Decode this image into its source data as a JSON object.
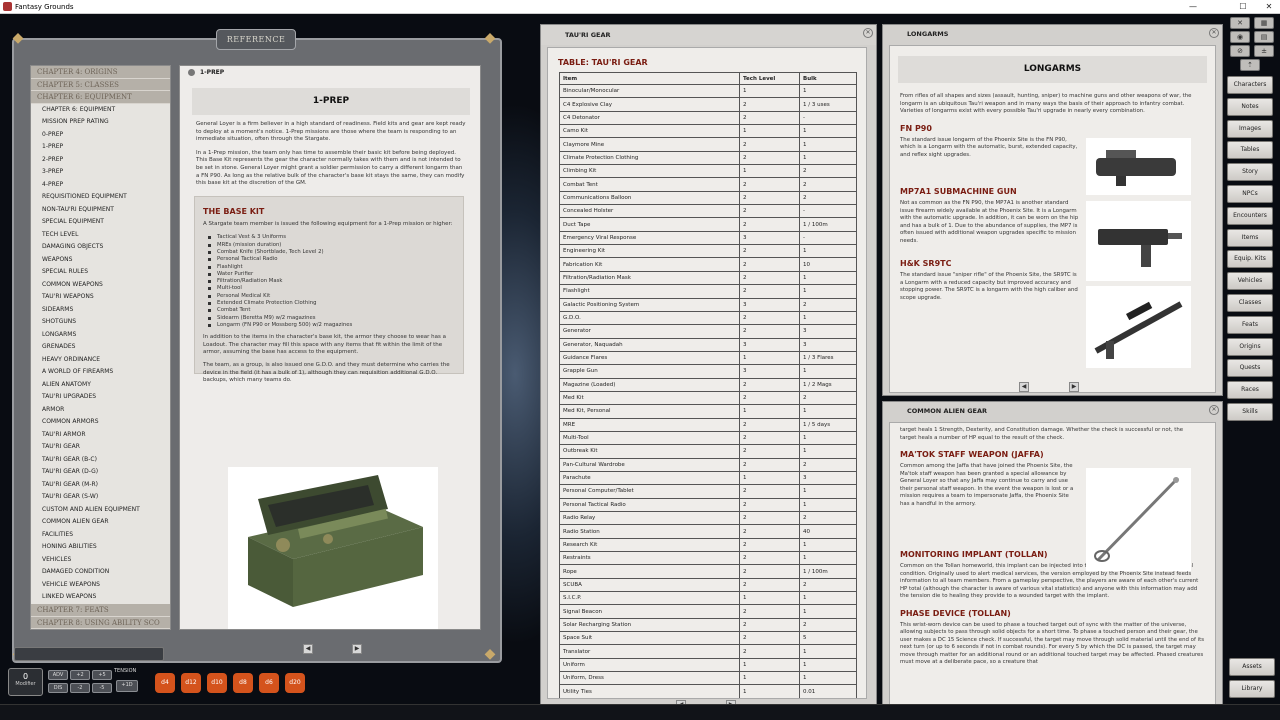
{
  "app": {
    "title": "Fantasy Grounds"
  },
  "window_controls": {
    "minimize": "—",
    "maximize": "☐",
    "close": "✕"
  },
  "reference": {
    "title": "REFERENCE",
    "toc": {
      "chapters_top": [
        "CHAPTER 4: ORIGINS",
        "CHAPTER 5: CLASSES",
        "CHAPTER 6: EQUIPMENT"
      ],
      "entries": [
        "CHAPTER 6: EQUIPMENT",
        "MISSION PREP RATING",
        "0-PREP",
        "1-PREP",
        "2-PREP",
        "3-PREP",
        "4-PREP",
        "REQUISITIONED EQUIPMENT",
        "NON-TAU'RI EQUIPMENT",
        "SPECIAL EQUIPMENT",
        "TECH LEVEL",
        "DAMAGING OBJECTS",
        "WEAPONS",
        "SPECIAL RULES",
        "COMMON WEAPONS",
        "TAU'RI WEAPONS",
        "SIDEARMS",
        "SHOTGUNS",
        "LONGARMS",
        "GRENADES",
        "HEAVY ORDINANCE",
        "A WORLD OF FIREARMS",
        "ALIEN ANATOMY",
        "TAU'RI UPGRADES",
        "ARMOR",
        "COMMON ARMORS",
        "TAU'RI ARMOR",
        "TAU'RI GEAR",
        "TAU'RI GEAR (B-C)",
        "TAU'RI GEAR (D-G)",
        "TAU'RI GEAR (M-R)",
        "TAU'RI GEAR (S-W)",
        "CUSTOM AND ALIEN EQUIPMENT",
        "COMMON ALIEN GEAR",
        "FACILITIES",
        "HONING ABILITIES",
        "VEHICLES",
        "DAMAGED CONDITION",
        "VEHICLE WEAPONS",
        "LINKED WEAPONS"
      ],
      "chapters_bottom": [
        "CHAPTER 7: FEATS",
        "CHAPTER 8: USING ABILITY SCO"
      ]
    },
    "content": {
      "subheader": "1-PREP",
      "banner": "1-PREP",
      "para1": "General Loyer is a firm believer in a high standard of readiness. Field kits and gear are kept ready to deploy at a moment's notice. 1-Prep missions are those where the team is responding to an immediate situation, often through the Stargate.",
      "para2": "In a 1-Prep mission, the team only has time to assemble their basic kit before being deployed. This Base Kit represents the gear the character normally takes with them and is not intended to be set in stone. General Loyer might grant a soldier permission to carry a different longarm than a FN P90. As long as the relative bulk of the character's base kit stays the same, they can modify this base kit at the discretion of the GM.",
      "basekit": {
        "title": "THE BASE KIT",
        "intro": "A Stargate team member is issued the following equipment for a 1-Prep mission or higher:",
        "items": [
          "Tactical Vest & 3 Uniforms",
          "MREs (mission duration)",
          "Combat Knife (Shortblade, Tech Level 2)",
          "Personal Tactical Radio",
          "Flashlight",
          "Water Purifier",
          "Filtration/Radiation Mask",
          "Multi-tool",
          "Personal Medical Kit",
          "Extended Climate Protection Clothing",
          "Combat Tent",
          "Sidearm (Beretta M9) w/2 magazines",
          "Longarm (FN P90 or Mossberg 500) w/2 magazines"
        ],
        "para3": "In addition to the items in the character's base kit, the armor they choose to wear has a Loadout. The character may fill this space with any items that fit within the limit of the armor, assuming the base has access to the equipment.",
        "para4": "The team, as a group, is also issued one G.D.O. and they must determine who carries the device in the field (it has a bulk of 1), although they can requisition additional G.D.O. backups, which many teams do."
      }
    }
  },
  "gear": {
    "title": "TAU'RI GEAR",
    "table_title": "TABLE: TAU'RI GEAR",
    "columns": [
      "Item",
      "Tech Level",
      "Bulk"
    ],
    "rows": [
      [
        "Binocular/Monocular",
        "1",
        "1"
      ],
      [
        "C4 Explosive Clay",
        "2",
        "1 / 3 uses"
      ],
      [
        "C4 Detonator",
        "2",
        "-"
      ],
      [
        "Camo Kit",
        "1",
        "1"
      ],
      [
        "Claymore Mine",
        "2",
        "1"
      ],
      [
        "Climate Protection Clothing",
        "2",
        "1"
      ],
      [
        "Climbing Kit",
        "1",
        "2"
      ],
      [
        "Combat Tent",
        "2",
        "2"
      ],
      [
        "Communications Balloon",
        "2",
        "2"
      ],
      [
        "Concealed Holster",
        "2",
        "-"
      ],
      [
        "Duct Tape",
        "2",
        "1 / 100m"
      ],
      [
        "Emergency Viral Response",
        "3",
        "-"
      ],
      [
        "Engineering Kit",
        "2",
        "1"
      ],
      [
        "Fabrication Kit",
        "2",
        "10"
      ],
      [
        "Filtration/Radiation Mask",
        "2",
        "1"
      ],
      [
        "Flashlight",
        "2",
        "1"
      ],
      [
        "Galactic Positioning System",
        "3",
        "2"
      ],
      [
        "G.D.O.",
        "2",
        "1"
      ],
      [
        "Generator",
        "2",
        "3"
      ],
      [
        "Generator, Naquadah",
        "3",
        "3"
      ],
      [
        "Guidance Flares",
        "1",
        "1 / 3 Flares"
      ],
      [
        "Grapple Gun",
        "3",
        "1"
      ],
      [
        "Magazine (Loaded)",
        "2",
        "1 / 2 Mags"
      ],
      [
        "Med Kit",
        "2",
        "2"
      ],
      [
        "Med Kit, Personal",
        "1",
        "1"
      ],
      [
        "MRE",
        "2",
        "1 / 5 days"
      ],
      [
        "Multi-Tool",
        "2",
        "1"
      ],
      [
        "Outbreak Kit",
        "2",
        "1"
      ],
      [
        "Pan-Cultural Wardrobe",
        "2",
        "2"
      ],
      [
        "Parachute",
        "1",
        "3"
      ],
      [
        "Personal Computer/Tablet",
        "2",
        "1"
      ],
      [
        "Personal Tactical Radio",
        "2",
        "1"
      ],
      [
        "Radio Relay",
        "2",
        "2"
      ],
      [
        "Radio Station",
        "2",
        "40"
      ],
      [
        "Research Kit",
        "2",
        "1"
      ],
      [
        "Restraints",
        "2",
        "1"
      ],
      [
        "Rope",
        "2",
        "1 / 100m"
      ],
      [
        "SCUBA",
        "2",
        "2"
      ],
      [
        "S.I.C.P.",
        "1",
        "1"
      ],
      [
        "Signal Beacon",
        "2",
        "1"
      ],
      [
        "Solar Recharging Station",
        "2",
        "2"
      ],
      [
        "Space Suit",
        "2",
        "5"
      ],
      [
        "Translator",
        "2",
        "1"
      ],
      [
        "Uniform",
        "1",
        "1"
      ],
      [
        "Uniform, Dress",
        "1",
        "1"
      ],
      [
        "Utility Ties",
        "1",
        "0.01"
      ]
    ]
  },
  "longarms": {
    "title": "LONGARMS",
    "banner": "LONGARMS",
    "intro": "From rifles of all shapes and sizes (assault, hunting, sniper) to machine guns and other weapons of war, the longarm is an ubiquitous Tau'ri weapon and in many ways the basis of their approach to infantry combat. Varieties of longarms exist with every possible Tau'ri upgrade in nearly every combination.",
    "weapons": [
      {
        "name": "FN P90",
        "desc": "The standard issue longarm of the Phoenix Site is the FN P90, which is a Longarm with the automatic, burst, extended capacity, and reflex sight upgrades."
      },
      {
        "name": "MP7A1 SUBMACHINE GUN",
        "desc": "Not as common as the FN P90, the MP7A1 is another standard issue firearm widely available at the Phoenix Site. It is a Longarm with the automatic upgrade. In addition, it can be worn on the hip and has a bulk of 1. Due to the abundance of supplies, the MP7 is often issued with additional weapon upgrades specific to mission needs."
      },
      {
        "name": "H&K SR9TC",
        "desc": "The standard issue \"sniper rifle\" of the Phoenix Site, the SR9TC is a Longarm with a reduced capacity but improved accuracy and stopping power. The SR9TC is a longarm with the high caliber and scope upgrade."
      }
    ]
  },
  "alien": {
    "title": "COMMON ALIEN GEAR",
    "lead": "target heals 1 Strength, Dexterity, and Constitution damage. Whether the check is successful or not, the target heals a number of HP equal to the result of the check.",
    "sections": [
      {
        "name": "MA'TOK STAFF WEAPON (JAFFA)",
        "desc": "Common among the Jaffa that have joined the Phoenix Site, the Ma'tok staff weapon has been granted a special allowance by General Loyer so that any Jaffa may continue to carry and use their personal staff weapon. In the event the weapon is lost or a mission requires a team to impersonate Jaffa, the Phoenix Site has a handful in the armory."
      },
      {
        "name": "MONITORING IMPLANT (TOLLAN)",
        "desc": "Common on the Tollan homeworld, this implant can be injected into team members to monitor their medical condition. Originally used to alert medical services, the version employed by the Phoenix Site instead feeds information to all team members. From a gameplay perspective, the players are aware of each other's current HP total (although the character is aware of various vital statistics) and anyone with this information may add the tension die to healing they provide to a wounded target with the implant."
      },
      {
        "name": "PHASE DEVICE (TOLLAN)",
        "desc": "This wrist-worn device can be used to phase a touched target out of sync with the matter of the universe, allowing subjects to pass through solid objects for a short time. To phase a touched person and their gear, the user makes a DC 15 Science check. If successful, the target may move through solid material until the end of its next turn (or up to 6 seconds if not in combat rounds). For every 5 by which the DC is passed, the target may move through matter for an additional round or an additional touched target may be affected. Phased creatures must move at a deliberate pace, so a creature that"
      }
    ]
  },
  "sidebar": {
    "buttons": [
      "Characters",
      "Notes",
      "Images",
      "Tables",
      "Story",
      "NPCs",
      "Encounters",
      "Items",
      "Equip. Kits",
      "Vehicles",
      "Classes",
      "Feats",
      "Origins",
      "Quests",
      "Races",
      "Skills"
    ],
    "bottom": [
      "Assets",
      "Library"
    ]
  },
  "hotbar": {
    "modifier_value": "0",
    "modifier_label": "Modifier",
    "buttons": [
      "ADV",
      "DIS",
      "+2",
      "-2",
      "+5",
      "-5"
    ],
    "tension_label": "TENSION",
    "tension_value": "+1D",
    "dice": [
      "d4",
      "d12",
      "d10",
      "d8",
      "d6",
      "d20"
    ]
  },
  "colors": {
    "accent_red": "#7a1d12",
    "dice_orange": "#d4531c",
    "panel_bg": "#efedea"
  }
}
